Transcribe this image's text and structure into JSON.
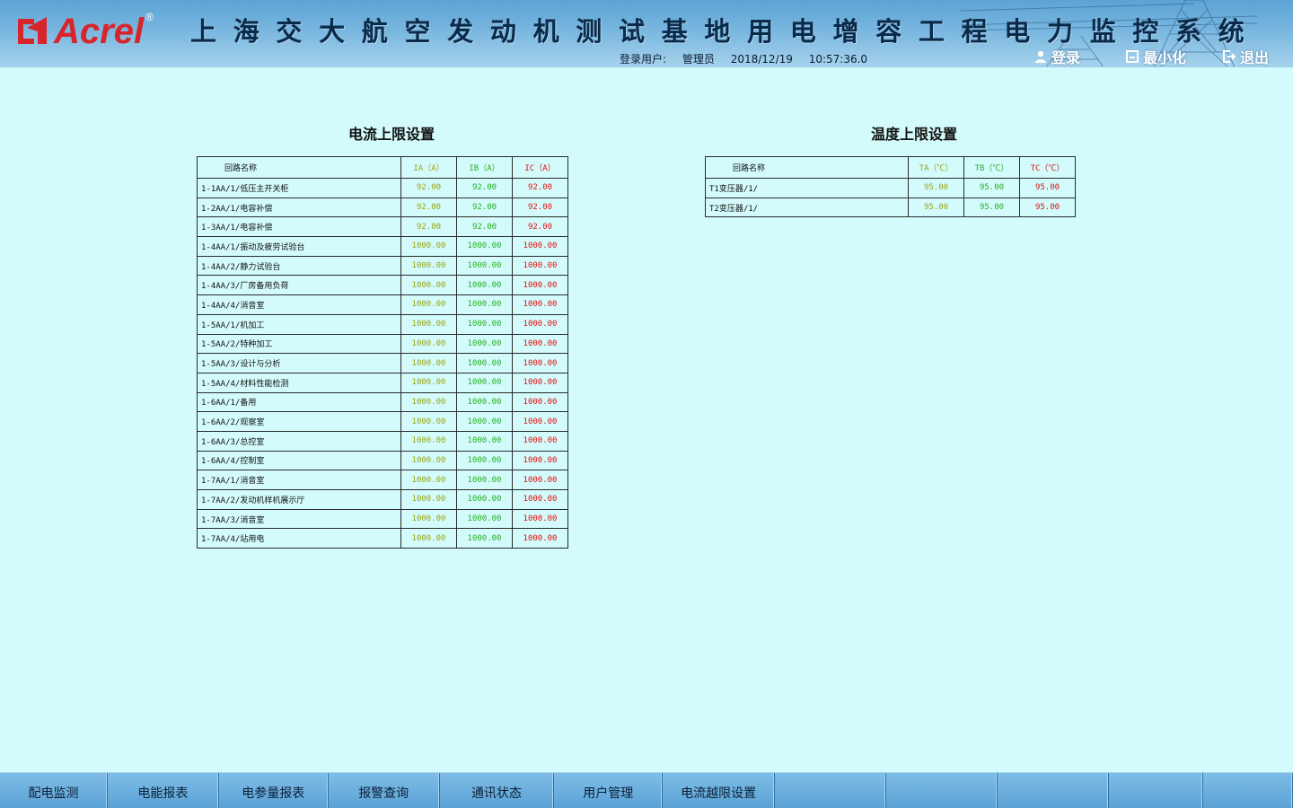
{
  "header": {
    "logo_text": "Acrel",
    "logo_reg": "®",
    "title": "上海交大航空发动机测试基地用电增容工程电力监控系统",
    "user_label": "登录用户:",
    "user_name": "管理员",
    "date": "2018/12/19",
    "time": "10:57:36.0",
    "buttons": {
      "login": "登录",
      "minimize": "最小化",
      "exit": "退出"
    }
  },
  "current_panel": {
    "title": "电流上限设置",
    "columns": [
      "回路名称",
      "IA（A）",
      "IB（A）",
      "IC（A）"
    ],
    "rows": [
      {
        "name": "1-1AA/1/低压主开关柜",
        "ia": "92.00",
        "ib": "92.00",
        "ic": "92.00"
      },
      {
        "name": "1-2AA/1/电容补偿",
        "ia": "92.00",
        "ib": "92.00",
        "ic": "92.00"
      },
      {
        "name": "1-3AA/1/电容补偿",
        "ia": "92.00",
        "ib": "92.00",
        "ic": "92.00"
      },
      {
        "name": "1-4AA/1/振动及疲劳试验台",
        "ia": "1000.00",
        "ib": "1000.00",
        "ic": "1000.00"
      },
      {
        "name": "1-4AA/2/静力试验台",
        "ia": "1000.00",
        "ib": "1000.00",
        "ic": "1000.00"
      },
      {
        "name": "1-4AA/3/厂房备用负荷",
        "ia": "1000.00",
        "ib": "1000.00",
        "ic": "1000.00"
      },
      {
        "name": "1-4AA/4/消音室",
        "ia": "1000.00",
        "ib": "1000.00",
        "ic": "1000.00"
      },
      {
        "name": "1-5AA/1/机加工",
        "ia": "1000.00",
        "ib": "1000.00",
        "ic": "1000.00"
      },
      {
        "name": "1-5AA/2/特种加工",
        "ia": "1000.00",
        "ib": "1000.00",
        "ic": "1000.00"
      },
      {
        "name": "1-5AA/3/设计与分析",
        "ia": "1000.00",
        "ib": "1000.00",
        "ic": "1000.00"
      },
      {
        "name": "1-5AA/4/材料性能检测",
        "ia": "1000.00",
        "ib": "1000.00",
        "ic": "1000.00"
      },
      {
        "name": "1-6AA/1/备用",
        "ia": "1000.00",
        "ib": "1000.00",
        "ic": "1000.00"
      },
      {
        "name": "1-6AA/2/观察室",
        "ia": "1000.00",
        "ib": "1000.00",
        "ic": "1000.00"
      },
      {
        "name": "1-6AA/3/总控室",
        "ia": "1000.00",
        "ib": "1000.00",
        "ic": "1000.00"
      },
      {
        "name": "1-6AA/4/控制室",
        "ia": "1000.00",
        "ib": "1000.00",
        "ic": "1000.00"
      },
      {
        "name": "1-7AA/1/消音室",
        "ia": "1000.00",
        "ib": "1000.00",
        "ic": "1000.00"
      },
      {
        "name": "1-7AA/2/发动机样机展示厅",
        "ia": "1000.00",
        "ib": "1000.00",
        "ic": "1000.00"
      },
      {
        "name": "1-7AA/3/消音室",
        "ia": "1000.00",
        "ib": "1000.00",
        "ic": "1000.00"
      },
      {
        "name": "1-7AA/4/站用电",
        "ia": "1000.00",
        "ib": "1000.00",
        "ic": "1000.00"
      }
    ]
  },
  "temp_panel": {
    "title": "温度上限设置",
    "columns": [
      "回路名称",
      "TA（℃）",
      "TB（℃）",
      "TC（℃）"
    ],
    "rows": [
      {
        "name": "T1变压器/1/",
        "ta": "95.00",
        "tb": "95.00",
        "tc": "95.00"
      },
      {
        "name": "T2变压器/1/",
        "ta": "95.00",
        "tb": "95.00",
        "tc": "95.00"
      }
    ]
  },
  "nav": {
    "items": [
      {
        "label": "配电监测"
      },
      {
        "label": "电能报表"
      },
      {
        "label": "电参量报表"
      },
      {
        "label": "报警查询"
      },
      {
        "label": "通讯状态"
      },
      {
        "label": "用户管理"
      },
      {
        "label": "电流越限设置"
      },
      {
        "label": ""
      },
      {
        "label": ""
      },
      {
        "label": ""
      },
      {
        "label": ""
      },
      {
        "label": ""
      }
    ]
  },
  "colors": {
    "background": "#d4fbfb",
    "phase_a": "#98a514",
    "phase_b": "#25b024",
    "phase_c": "#e01010",
    "logo_red": "#d8242b"
  },
  "icons": [
    "acrel-logo-icon",
    "tower-icon",
    "user-icon",
    "minimize-icon",
    "exit-icon"
  ]
}
